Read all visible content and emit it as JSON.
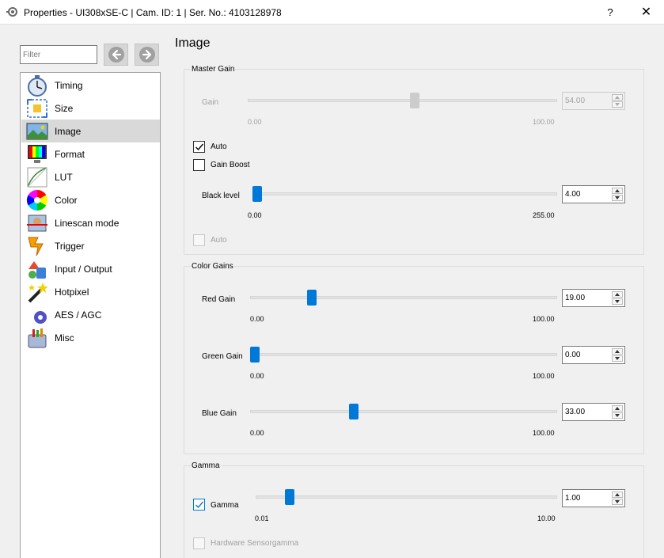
{
  "window": {
    "title": "Properties - UI308xSE-C | Cam. ID: 1 | Ser. No.: 4103128978",
    "help_label": "?",
    "close_label": "✕"
  },
  "filter": {
    "placeholder": "Filter",
    "value": ""
  },
  "nav": [
    {
      "label": "Timing",
      "icon": "stopwatch-icon"
    },
    {
      "label": "Size",
      "icon": "size-frame-icon"
    },
    {
      "label": "Image",
      "icon": "landscape-image-icon",
      "selected": true
    },
    {
      "label": "Format",
      "icon": "monitor-color-bars-icon"
    },
    {
      "label": "LUT",
      "icon": "lut-curve-icon"
    },
    {
      "label": "Color",
      "icon": "color-wheel-icon"
    },
    {
      "label": "Linescan mode",
      "icon": "linescan-icon"
    },
    {
      "label": "Trigger",
      "icon": "trigger-bolt-icon"
    },
    {
      "label": "Input / Output",
      "icon": "input-output-icon"
    },
    {
      "label": "Hotpixel",
      "icon": "magic-wand-icon"
    },
    {
      "label": "AES / AGC",
      "icon": "auto-exposure-gear-icon"
    },
    {
      "label": "Misc",
      "icon": "toolbox-icon"
    }
  ],
  "page_title": "Image",
  "master_gain": {
    "title": "Master Gain",
    "gain": {
      "label": "Gain",
      "min": "0.00",
      "max": "100.00",
      "value": "54.00",
      "fraction": 0.54,
      "enabled": false
    },
    "auto_label": "Auto",
    "auto_checked": true,
    "gain_boost_label": "Gain Boost",
    "gain_boost_checked": false,
    "black_level": {
      "label": "Black level",
      "min": "0.00",
      "max": "255.00",
      "value": "4.00",
      "fraction": 0.0157,
      "enabled": true
    },
    "black_auto_label": "Auto",
    "black_auto_checked": false
  },
  "color_gains": {
    "title": "Color Gains",
    "red": {
      "label": "Red Gain",
      "min": "0.00",
      "max": "100.00",
      "value": "19.00",
      "fraction": 0.19
    },
    "green": {
      "label": "Green Gain",
      "min": "0.00",
      "max": "100.00",
      "value": "0.00",
      "fraction": 0.0
    },
    "blue": {
      "label": "Blue Gain",
      "min": "0.00",
      "max": "100.00",
      "value": "33.00",
      "fraction": 0.33
    }
  },
  "gamma": {
    "title": "Gamma",
    "gamma_label": "Gamma",
    "gamma_checked": true,
    "slider": {
      "min": "0.01",
      "max": "10.00",
      "value": "1.00",
      "fraction": 0.099
    },
    "hw_label": "Hardware Sensorgamma",
    "hw_checked": false
  },
  "colors": {
    "accent": "#0078d7",
    "disabled": "#a0a0a0",
    "selection": "#d9d9d9"
  }
}
